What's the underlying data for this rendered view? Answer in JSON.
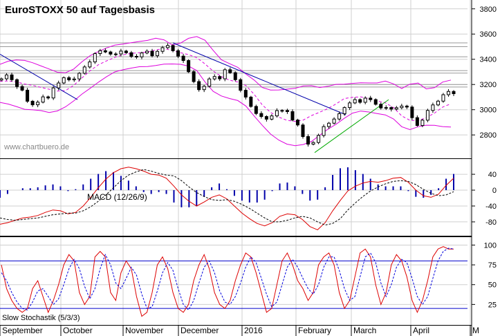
{
  "chart_data": {
    "type": "candlestick",
    "title": "EuroSTOXX 50 auf Tagesbasis",
    "watermark": "www.chartbuero.de",
    "x_months": [
      "September",
      "October",
      "November",
      "December",
      "2016",
      "February",
      "March",
      "April",
      "M"
    ],
    "colors": {
      "candle": "#000000",
      "bollinger": "#dd00dd",
      "moving_average": "#dd00dd",
      "trendline": "#0000aa",
      "support_line": "#00aa00",
      "macd": "#dd0000",
      "signal": "#000000",
      "histogram": "#0000aa",
      "stoch_k": "#dd0000",
      "stoch_d": "#0000dd",
      "level_lines": "#0000cc"
    },
    "panels": [
      {
        "name": "price",
        "yticks": [
          2800,
          3000,
          3200,
          3400,
          3600,
          3800
        ],
        "ylim": [
          2620,
          3870
        ],
        "horizontal_levels": [
          3530,
          3500,
          3420,
          3310,
          3290,
          3200,
          3180
        ],
        "series": {
          "close": [
            3245,
            3276,
            3238,
            3184,
            3155,
            3067,
            3039,
            3060,
            3102,
            3093,
            3173,
            3212,
            3254,
            3237,
            3244,
            3289,
            3339,
            3379,
            3445,
            3468,
            3458,
            3441,
            3442,
            3465,
            3452,
            3423,
            3419,
            3450,
            3464,
            3428,
            3463,
            3492,
            3509,
            3468,
            3425,
            3390,
            3301,
            3223,
            3159,
            3186,
            3244,
            3263,
            3245,
            3317,
            3294,
            3238,
            3154,
            3100,
            3026,
            2970,
            2946,
            2925,
            2951,
            2993,
            2994,
            2985,
            2918,
            2879,
            2787,
            2727,
            2740,
            2796,
            2866,
            2893,
            2926,
            2968,
            3017,
            3054,
            3080,
            3059,
            3092,
            3080,
            3043,
            3014,
            3017,
            3005,
            3016,
            3029,
            3021,
            2937,
            2875,
            2917,
            2994,
            3038,
            3068,
            3119,
            3145,
            3127
          ],
          "bollinger_upper": [
            3360,
            3385,
            3394,
            3391,
            3372,
            3347,
            3323,
            3297,
            3293,
            3323,
            3380,
            3429,
            3461,
            3490,
            3512,
            3521,
            3531,
            3541,
            3550,
            3567,
            3554,
            3514,
            3528,
            3566,
            3580,
            3551,
            3471,
            3396,
            3365,
            3336,
            3283,
            3235,
            3176,
            3156,
            3157,
            3163,
            3170,
            3188,
            3190,
            3176,
            3186,
            3201,
            3202,
            3209,
            3213,
            3212,
            3212,
            3227,
            3205,
            3168,
            3203,
            3211,
            3165,
            3175,
            3219,
            3235
          ],
          "moving_average": [
            3226,
            3228,
            3221,
            3204,
            3193,
            3177,
            3162,
            3148,
            3152,
            3194,
            3252,
            3309,
            3357,
            3387,
            3415,
            3436,
            3446,
            3452,
            3457,
            3474,
            3485,
            3470,
            3452,
            3437,
            3413,
            3363,
            3307,
            3262,
            3234,
            3220,
            3192,
            3122,
            3038,
            2979,
            2941,
            2916,
            2907,
            2918,
            2954,
            2980,
            3009,
            3046,
            3089,
            3098,
            3102,
            3088,
            3069,
            3055,
            3017,
            2951,
            2916,
            2914,
            2937,
            2973,
            3021,
            3047
          ],
          "bollinger_lower": [
            3058,
            3045,
            3025,
            3003,
            2999,
            2993,
            2978,
            2990,
            3023,
            3070,
            3124,
            3170,
            3218,
            3262,
            3300,
            3317,
            3330,
            3341,
            3342,
            3351,
            3362,
            3363,
            3360,
            3346,
            3311,
            3221,
            3146,
            3109,
            3089,
            3073,
            3029,
            2950,
            2876,
            2807,
            2759,
            2727,
            2715,
            2724,
            2749,
            2797,
            2846,
            2885,
            2932,
            2973,
            2989,
            2982,
            2970,
            2959,
            2927,
            2865,
            2842,
            2865,
            2877,
            2876,
            2866,
            2863
          ]
        }
      },
      {
        "name": "macd",
        "label": "MACD (12/26/9)",
        "yticks": [
          40,
          0,
          -40,
          -80
        ],
        "ylim": [
          -115,
          75
        ],
        "zero_line": 0,
        "series": {
          "macd": [
            -86,
            -82,
            -76,
            -70,
            -68,
            -64,
            -56,
            -50,
            -52,
            -60,
            -56,
            -40,
            -18,
            6,
            28,
            44,
            54,
            58,
            54,
            48,
            40,
            38,
            30,
            10,
            -12,
            -28,
            -40,
            -30,
            -18,
            -12,
            -22,
            -40,
            -58,
            -72,
            -84,
            -90,
            -82,
            -66,
            -60,
            -62,
            -74,
            -92,
            -100,
            -82,
            -52,
            -26,
            -2,
            10,
            18,
            22,
            20,
            24,
            30,
            32,
            20,
            0,
            -14,
            -18,
            -10,
            12,
            30
          ],
          "signal": [
            -70,
            -74,
            -76,
            -74,
            -72,
            -70,
            -66,
            -62,
            -60,
            -58,
            -58,
            -52,
            -42,
            -28,
            -12,
            6,
            24,
            38,
            46,
            52,
            48,
            42,
            38,
            36,
            24,
            8,
            -6,
            -16,
            -24,
            -26,
            -24,
            -28,
            -36,
            -46,
            -58,
            -70,
            -80,
            -80,
            -76,
            -70,
            -66,
            -70,
            -80,
            -88,
            -84,
            -72,
            -50,
            -32,
            -16,
            -2,
            8,
            16,
            22,
            24,
            22,
            14,
            2,
            -8,
            -14,
            -12,
            -4
          ]
        }
      },
      {
        "name": "stochastic",
        "label": "Slow Stochastik (5/3/3)",
        "yticks": [
          100,
          75,
          50,
          25
        ],
        "ylim": [
          0,
          110
        ],
        "horizontal_levels": [
          80,
          20
        ],
        "series": {
          "k": [
            75,
            45,
            30,
            20,
            15,
            20,
            45,
            55,
            35,
            15,
            30,
            50,
            75,
            88,
            80,
            40,
            25,
            35,
            85,
            92,
            85,
            40,
            30,
            65,
            80,
            70,
            35,
            10,
            15,
            40,
            75,
            85,
            70,
            40,
            20,
            15,
            25,
            55,
            75,
            88,
            70,
            40,
            25,
            20,
            30,
            55,
            75,
            90,
            85,
            65,
            40,
            15,
            20,
            50,
            80,
            90,
            75,
            55,
            45,
            30,
            40,
            75,
            85,
            90,
            75,
            40,
            20,
            30,
            60,
            90,
            95,
            85,
            50,
            25,
            40,
            75,
            88,
            80,
            60,
            30,
            15,
            30,
            55,
            85,
            95,
            98,
            95,
            95
          ],
          "d": [
            65,
            55,
            40,
            28,
            20,
            18,
            28,
            42,
            45,
            35,
            25,
            32,
            50,
            70,
            82,
            70,
            48,
            32,
            45,
            70,
            88,
            75,
            52,
            45,
            58,
            72,
            62,
            38,
            20,
            22,
            42,
            65,
            78,
            68,
            45,
            25,
            18,
            30,
            52,
            72,
            80,
            65,
            42,
            28,
            25,
            35,
            52,
            72,
            85,
            78,
            58,
            38,
            22,
            28,
            50,
            72,
            82,
            72,
            58,
            45,
            38,
            50,
            72,
            85,
            85,
            68,
            45,
            30,
            35,
            60,
            85,
            90,
            78,
            52,
            35,
            50,
            72,
            82,
            78,
            58,
            35,
            25,
            35,
            58,
            80,
            92,
            96,
            95
          ]
        }
      }
    ]
  }
}
